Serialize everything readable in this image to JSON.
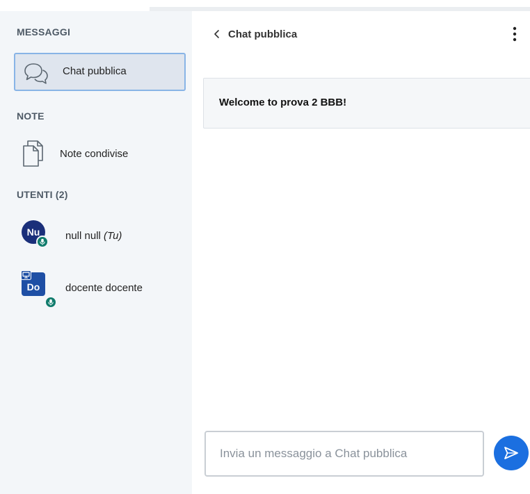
{
  "sidebar": {
    "messages_title": "MESSAGGI",
    "public_chat_label": "Chat pubblica",
    "notes_title": "NOTE",
    "shared_notes_label": "Note condivise",
    "users_title": "UTENTI (2)",
    "users": [
      {
        "initials": "Nu",
        "name": "null null",
        "you_label": "(Tu)",
        "presenter": false,
        "mic_active": true
      },
      {
        "initials": "Do",
        "name": "docente docente",
        "presenter": true,
        "mic_active": true
      }
    ]
  },
  "chat": {
    "title": "Chat pubblica",
    "welcome_message": "Welcome to prova 2 BBB!",
    "input_placeholder": "Invia un messaggio a Chat pubblica"
  },
  "icons": {
    "public_chat": "chat-bubbles-icon",
    "shared_notes": "documents-icon",
    "back": "chevron-left-icon",
    "menu": "vertical-dots-icon",
    "microphone": "microphone-icon",
    "presenter": "presenter-screen-icon",
    "send": "send-arrow-icon"
  },
  "colors": {
    "sidebar_bg": "#f3f6f9",
    "selected_item_bg": "#dfe5ee",
    "selected_item_border": "#88b4e6",
    "avatar_user_1": "#1a2f7a",
    "avatar_user_2": "#1e4fa5",
    "mic_badge": "#0f7b6c",
    "send_button": "#1b6fe0"
  }
}
